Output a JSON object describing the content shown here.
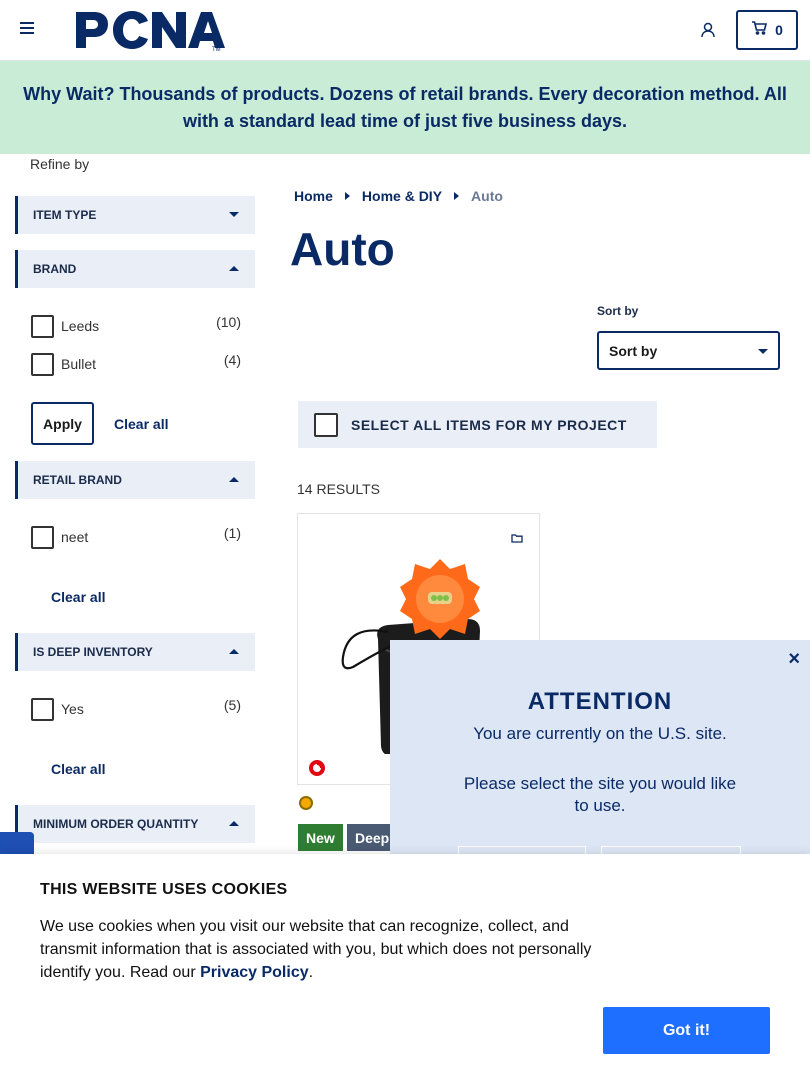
{
  "header": {
    "logo_text": "PCNA",
    "cart_count": "0"
  },
  "promo": {
    "text": "Why Wait? Thousands of products. Dozens of retail brands. Every decoration method. All with a standard lead time of just five business days."
  },
  "sidebar": {
    "refine_label": "Refine by",
    "facets": [
      {
        "title": "ITEM TYPE",
        "expanded": false
      },
      {
        "title": "BRAND",
        "expanded": true,
        "options": [
          {
            "label": "Leeds",
            "count": "(10)"
          },
          {
            "label": "Bullet",
            "count": "(4)"
          }
        ],
        "apply_label": "Apply",
        "clear_label": "Clear all"
      },
      {
        "title": "RETAIL BRAND",
        "expanded": true,
        "options": [
          {
            "label": "neet",
            "count": "(1)"
          }
        ],
        "clear_label": "Clear all"
      },
      {
        "title": "IS DEEP INVENTORY",
        "expanded": true,
        "options": [
          {
            "label": "Yes",
            "count": "(5)"
          }
        ],
        "clear_label": "Clear all"
      },
      {
        "title": "MINIMUM ORDER QUANTITY",
        "expanded": true
      }
    ]
  },
  "breadcrumb": [
    {
      "label": "Home"
    },
    {
      "label": "Home & DIY"
    },
    {
      "label": "Auto"
    }
  ],
  "page_title": "Auto",
  "sort": {
    "label": "Sort by",
    "selected": "Sort by"
  },
  "select_all_label": "SELECT ALL ITEMS FOR MY PROJECT",
  "results_count": "14 RESULTS",
  "product": {
    "tags": [
      "New",
      "Deep"
    ],
    "swatch_color": "#f5a800"
  },
  "attention": {
    "title": "ATTENTION",
    "line1": "You are currently on the U.S. site.",
    "line2": "Please select the site you would like to use.",
    "close": "×"
  },
  "cookie": {
    "title": "THIS WEBSITE USES COOKIES",
    "text_before": "We use cookies when you visit our website that can recognize, collect, and transmit information that is associated with you, but which does not personally identify you. Read our ",
    "link": "Privacy Policy",
    "text_after": ".",
    "button": "Got it!"
  },
  "colors": {
    "navy": "#0a2a66",
    "promo_bg": "#c9ecd6",
    "facet_bg": "#e9eef7",
    "cta_blue": "#1e6fff"
  }
}
